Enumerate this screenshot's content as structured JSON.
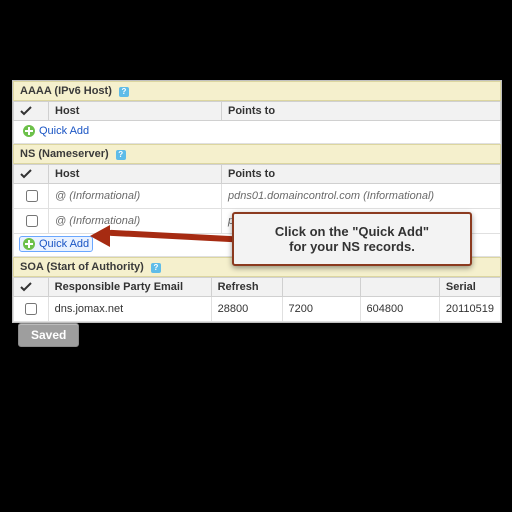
{
  "sections": {
    "aaaa": {
      "title": "AAAA (IPv6 Host)",
      "columns": {
        "host": "Host",
        "points_to": "Points to"
      },
      "quick_add": "Quick Add"
    },
    "ns": {
      "title": "NS (Nameserver)",
      "columns": {
        "host": "Host",
        "points_to": "Points to"
      },
      "rows": [
        {
          "host": "@ (Informational)",
          "points_to": "pdns01.domaincontrol.com (Informational)"
        },
        {
          "host": "@ (Informational)",
          "points_to": "pdns02.domaincontrol.com (Informational)"
        }
      ],
      "quick_add": "Quick Add"
    },
    "soa": {
      "title": "SOA (Start of Authority)",
      "columns": {
        "email": "Responsible Party Email",
        "refresh": "Refresh",
        "c3": "",
        "c4": "",
        "serial": "Serial"
      },
      "rows": [
        {
          "email": "dns.jomax.net",
          "refresh": "28800",
          "c3": "7200",
          "c4": "604800",
          "serial": "20110519"
        }
      ]
    }
  },
  "callout": {
    "line1": "Click on the \"Quick Add\"",
    "line2": "for your NS records."
  },
  "saved_button": "Saved",
  "help_label": "?"
}
